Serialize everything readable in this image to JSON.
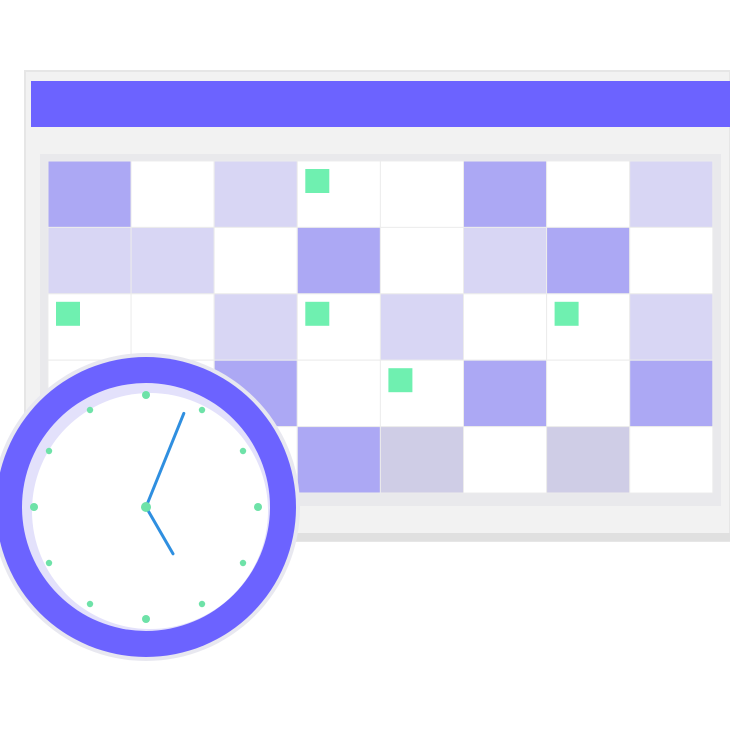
{
  "illustration": {
    "calendar": {
      "columns": 8,
      "rows": 5,
      "colors": {
        "frame": "#f2f2f2",
        "frame_edge": "#e6e6e6",
        "frame_bottom": "#e0e0e0",
        "header_bar": "#6c63ff",
        "grid_line": "#ececec",
        "cell_blank": "#ffffff",
        "cell_light": "#d8d6f4",
        "cell_medium": "#aca8f4",
        "cell_gray": "#cfcde6",
        "event_marker": "#6ff0b0"
      },
      "cells": [
        [
          "medium",
          "blank",
          "light",
          "blank",
          "blank",
          "medium",
          "blank",
          "light"
        ],
        [
          "light",
          "light",
          "blank",
          "medium",
          "blank",
          "light",
          "medium",
          "blank"
        ],
        [
          "blank",
          "blank",
          "light",
          "blank",
          "light",
          "blank",
          "blank",
          "light"
        ],
        [
          "blank",
          "blank",
          "medium",
          "blank",
          "blank",
          "medium",
          "blank",
          "medium"
        ],
        [
          "blank",
          "blank",
          "blank",
          "medium",
          "gray",
          "blank",
          "gray",
          "blank"
        ]
      ],
      "event_markers": [
        {
          "row": 0,
          "col": 3
        },
        {
          "row": 2,
          "col": 0
        },
        {
          "row": 2,
          "col": 3
        },
        {
          "row": 2,
          "col": 6
        },
        {
          "row": 3,
          "col": 4
        }
      ]
    },
    "clock": {
      "hour_marks": 12,
      "hour_hand_angle_deg": 150,
      "minute_hand_angle_deg": 22,
      "colors": {
        "rim": "#6c63ff",
        "rim_shadow": "#e8e8f0",
        "face_ring": "#e3e1fb",
        "face": "#ffffff",
        "hands": "#2f8fe0",
        "hour_marks": "#6ee2a8",
        "center": "#6ee2a8"
      }
    }
  }
}
